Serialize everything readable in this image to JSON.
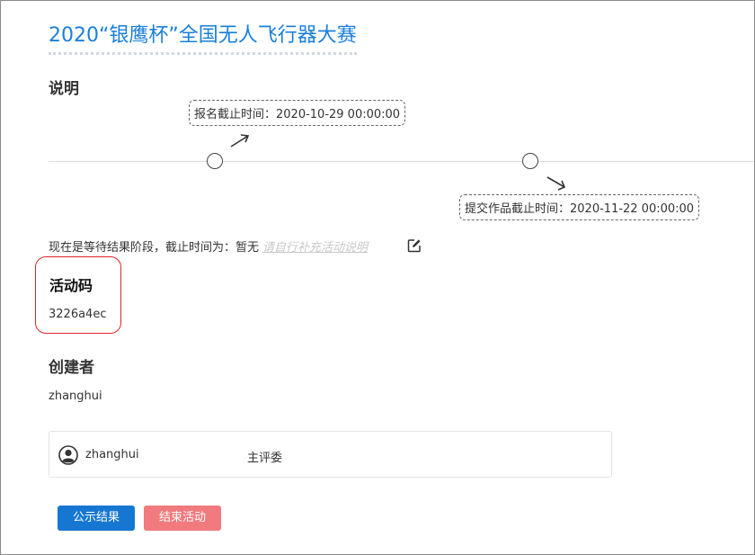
{
  "activity": {
    "title": "2020“银鹰杯”全国无人飞行器大赛"
  },
  "description": {
    "heading": "说明",
    "timeline": [
      {
        "label": "报名截止时间：2020-10-29 00:00:00"
      },
      {
        "label": "提交作品截止时间：2020-11-22 00:00:00"
      }
    ],
    "status_text": "现在是等待结果阶段，截止时间为：暂无",
    "status_link": "请自行补充活动说明"
  },
  "activity_code": {
    "label": "活动码",
    "value": "3226a4ec"
  },
  "creator": {
    "heading": "创建者",
    "name": "zhanghui"
  },
  "members": [
    {
      "name": "zhanghui",
      "role": "主评委"
    }
  ],
  "actions": {
    "publish_label": "公示结果",
    "end_label": "结束活动"
  },
  "colors": {
    "title": "#1a7fd9",
    "primary_button": "#1677d2",
    "danger_button": "#f07a7d",
    "highlight_border": "#e0262b"
  },
  "icons": {
    "edit": "edit-icon",
    "avatar": "user-circle-icon",
    "arrow_up": "arrow-up-right-icon",
    "arrow_down": "arrow-down-right-icon"
  }
}
